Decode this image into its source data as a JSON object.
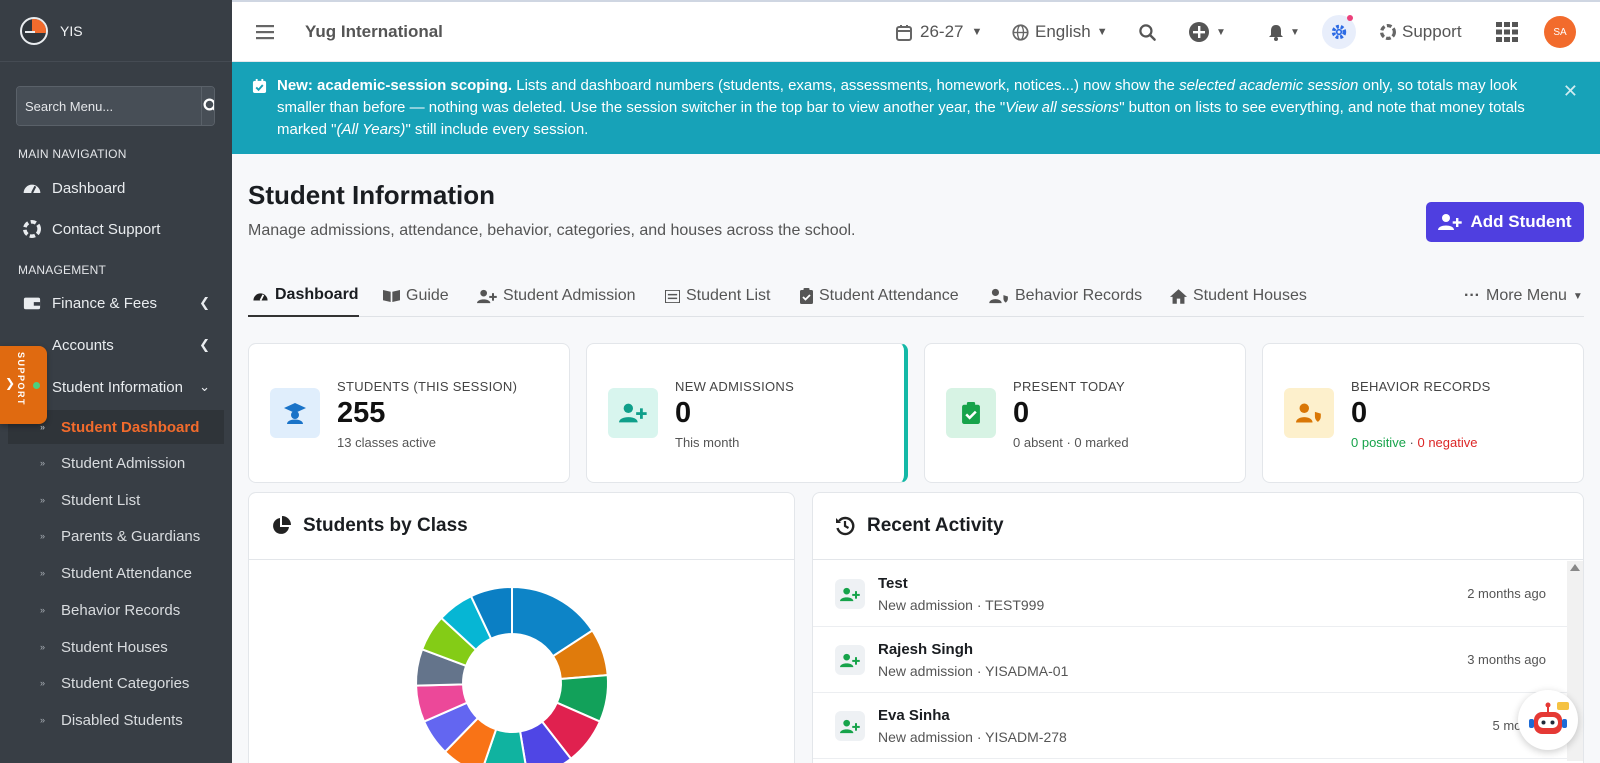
{
  "sidebar": {
    "brand": "YIS",
    "search_placeholder": "Search Menu...",
    "sections": {
      "main": "MAIN NAVIGATION",
      "management": "MANAGEMENT"
    },
    "items": [
      {
        "label": "Dashboard",
        "icon": "gauge-icon"
      },
      {
        "label": "Contact Support",
        "icon": "lifebuoy-icon"
      },
      {
        "label": "Finance & Fees",
        "icon": "wallet-icon"
      },
      {
        "label": "Accounts",
        "icon": "book-icon"
      },
      {
        "label": "Student Information",
        "icon": "user-icon"
      }
    ],
    "sub_items": [
      "Student Dashboard",
      "Student Admission",
      "Student List",
      "Parents & Guardians",
      "Student Attendance",
      "Behavior Records",
      "Student Houses",
      "Student Categories",
      "Disabled Students"
    ],
    "support_tab": "SUPPORT"
  },
  "topbar": {
    "school": "Yug International",
    "session": "26-27",
    "language": "English",
    "support": "Support",
    "avatar": "SA"
  },
  "banner": {
    "bold": "New: academic-session scoping.",
    "t1": " Lists and dashboard numbers (students, exams, assessments, homework, notices...) now show the ",
    "em1": "selected academic session",
    "t2": " only, so totals may look smaller than before — nothing was deleted. Use the session switcher in the top bar to view another year, the \"",
    "em2": "View all sessions",
    "t3": "\" button on lists to see everything, and note that money totals marked \"",
    "em3": "(All Years)",
    "t4": "\" still include every session."
  },
  "page": {
    "title": "Student Information",
    "subtitle": "Manage admissions, attendance, behavior, categories, and houses across the school.",
    "add_button": "Add Student"
  },
  "tabs": [
    "Dashboard",
    "Guide",
    "Student Admission",
    "Student List",
    "Student Attendance",
    "Behavior Records",
    "Student Houses",
    "More Menu"
  ],
  "stats": [
    {
      "label": "STUDENTS (THIS SESSION)",
      "value": "255",
      "sub": "13 classes active"
    },
    {
      "label": "NEW ADMISSIONS",
      "value": "0",
      "sub": "This month"
    },
    {
      "label": "PRESENT TODAY",
      "value": "0",
      "sub": "0 absent · 0 marked"
    },
    {
      "label": "BEHAVIOR RECORDS",
      "value": "0",
      "sub_pos": "0 positive",
      "sub_sep": " · ",
      "sub_neg": "0 negative"
    }
  ],
  "panels": {
    "classes_title": "Students by Class",
    "activity_title": "Recent Activity"
  },
  "activity": [
    {
      "name": "Test",
      "desc": "New admission · TEST999",
      "time": "2 months ago"
    },
    {
      "name": "Rajesh Singh",
      "desc": "New admission · YISADMA-01",
      "time": "3 months ago"
    },
    {
      "name": "Eva Sinha",
      "desc": "New admission · YISADM-278",
      "time": "5 months"
    }
  ],
  "chart_data": {
    "type": "pie",
    "variant": "donut",
    "values": [
      18,
      9,
      9,
      9,
      9,
      9,
      8,
      7,
      7,
      7,
      7,
      7,
      8
    ],
    "colors": [
      "#0d84c7",
      "#e07b0c",
      "#12a15a",
      "#e0214f",
      "#4f46e5",
      "#10b3a0",
      "#f97316",
      "#6366f1",
      "#ec4899",
      "#64748b",
      "#84cc16",
      "#06b6d4",
      "#0b7fc4"
    ]
  }
}
